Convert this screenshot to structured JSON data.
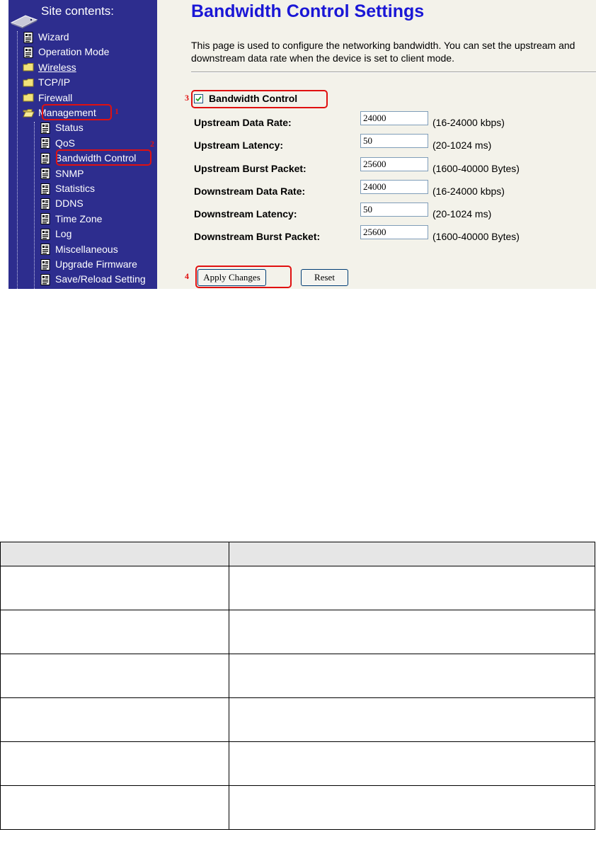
{
  "sidebar": {
    "title": "Site contents:",
    "items": [
      {
        "label": "Wizard",
        "icon": "page-icon",
        "level": 1
      },
      {
        "label": "Operation Mode",
        "icon": "page-icon",
        "level": 1
      },
      {
        "label": "Wireless",
        "icon": "folder-icon",
        "level": 1
      },
      {
        "label": "TCP/IP",
        "icon": "folder-icon",
        "level": 1
      },
      {
        "label": "Firewall",
        "icon": "folder-icon",
        "level": 1
      },
      {
        "label": "Management",
        "icon": "open-folder-icon",
        "level": 1
      },
      {
        "label": "Status",
        "icon": "page-icon",
        "level": 2
      },
      {
        "label": "QoS",
        "icon": "page-icon",
        "level": 2
      },
      {
        "label": "Bandwidth Control",
        "icon": "page-icon",
        "level": 2
      },
      {
        "label": "SNMP",
        "icon": "page-icon",
        "level": 2
      },
      {
        "label": "Statistics",
        "icon": "page-icon",
        "level": 2
      },
      {
        "label": "DDNS",
        "icon": "page-icon",
        "level": 2
      },
      {
        "label": "Time Zone",
        "icon": "page-icon",
        "level": 2
      },
      {
        "label": "Log",
        "icon": "page-icon",
        "level": 2
      },
      {
        "label": "Miscellaneous",
        "icon": "page-icon",
        "level": 2
      },
      {
        "label": "Upgrade Firmware",
        "icon": "page-icon",
        "level": 2
      },
      {
        "label": "Save/Reload Setting",
        "icon": "page-icon",
        "level": 2
      }
    ]
  },
  "content": {
    "title": "Bandwidth Control Settings",
    "description": "This page is used to configure the networking bandwidth. You can set the upstream and downstream data rate when the device is set to client mode.",
    "bandwidth_control": {
      "label": "Bandwidth Control",
      "checked": true
    },
    "fields": [
      {
        "label": "Upstream Data Rate:",
        "value": "24000",
        "hint": "(16-24000 kbps)"
      },
      {
        "label": "Upstream Latency:",
        "value": "50",
        "hint": "(20-1024 ms)"
      },
      {
        "label": "Upstream Burst Packet:",
        "value": "25600",
        "hint": "(1600-40000 Bytes)"
      },
      {
        "label": "Downstream Data Rate:",
        "value": "24000",
        "hint": "(16-24000 kbps)"
      },
      {
        "label": "Downstream Latency:",
        "value": "50",
        "hint": "(20-1024 ms)"
      },
      {
        "label": "Downstream Burst Packet:",
        "value": "25600",
        "hint": "(1600-40000 Bytes)"
      }
    ],
    "buttons": {
      "apply": "Apply Changes",
      "reset": "Reset"
    }
  },
  "callouts": [
    "1",
    "2",
    "3",
    "4"
  ],
  "colors": {
    "sidebar_bg": "#2d2d8e",
    "content_bg": "#f3f2ea",
    "title_blue": "#1a17d6",
    "callout_red": "#e01010"
  },
  "table": {
    "rows": 6,
    "columns": 2
  }
}
